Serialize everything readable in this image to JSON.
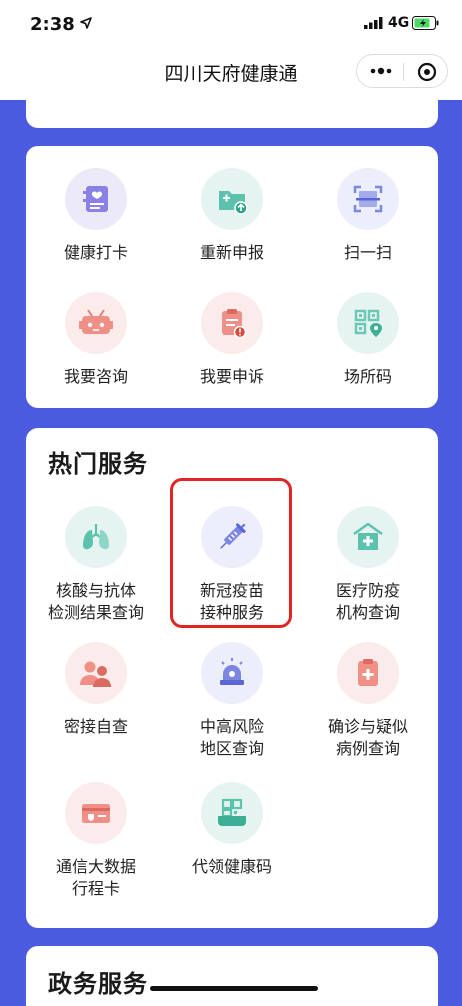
{
  "status_bar": {
    "time": "2:38",
    "network": "4G"
  },
  "nav": {
    "title": "四川天府健康通"
  },
  "quick_actions": [
    {
      "label": "健康打卡",
      "icon": "health-checkin-icon"
    },
    {
      "label": "重新申报",
      "icon": "resubmit-icon"
    },
    {
      "label": "扫一扫",
      "icon": "scan-icon"
    },
    {
      "label": "我要咨询",
      "icon": "robot-consult-icon"
    },
    {
      "label": "我要申诉",
      "icon": "appeal-icon"
    },
    {
      "label": "场所码",
      "icon": "venue-qr-icon"
    }
  ],
  "hot_services": {
    "title": "热门服务",
    "items": [
      {
        "line1": "核酸与抗体",
        "line2": "检测结果查询",
        "icon": "lungs-icon"
      },
      {
        "line1": "新冠疫苗",
        "line2": "接种服务",
        "icon": "syringe-icon"
      },
      {
        "line1": "医疗防疫",
        "line2": "机构查询",
        "icon": "hospital-icon"
      },
      {
        "line1": "密接自查",
        "line2": "",
        "icon": "contacts-icon"
      },
      {
        "line1": "中高风险",
        "line2": "地区查询",
        "icon": "alarm-icon"
      },
      {
        "line1": "确诊与疑似",
        "line2": "病例查询",
        "icon": "clipboard-icon"
      },
      {
        "line1": "通信大数据",
        "line2": "行程卡",
        "icon": "itinerary-card-icon"
      },
      {
        "line1": "代领健康码",
        "line2": "",
        "icon": "proxy-health-code-icon"
      }
    ]
  },
  "gov_services": {
    "title": "政务服务"
  },
  "colors": {
    "background": "#4a5be0",
    "highlight": "#e32424"
  }
}
